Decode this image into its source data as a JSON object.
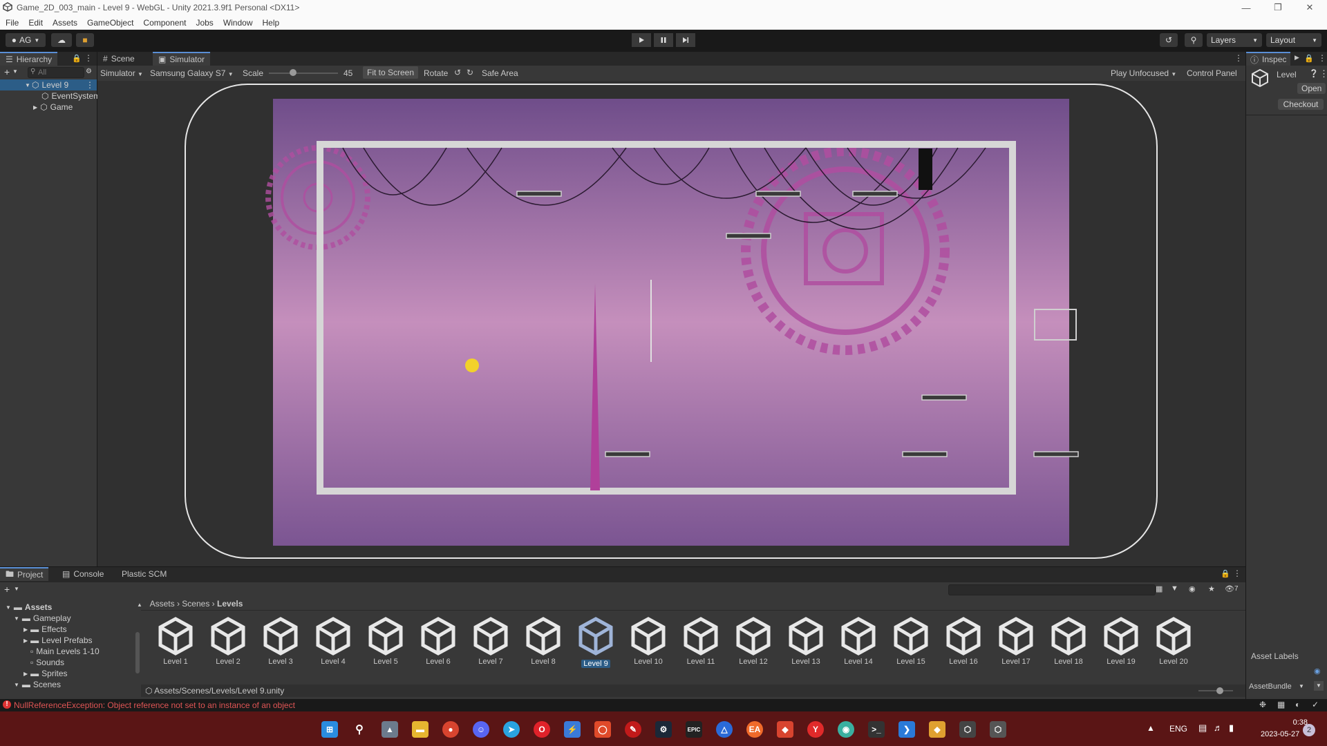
{
  "window": {
    "title": "Game_2D_003_main - Level 9 - WebGL - Unity 2021.3.9f1 Personal <DX11>"
  },
  "menu": [
    "File",
    "Edit",
    "Assets",
    "GameObject",
    "Component",
    "Jobs",
    "Window",
    "Help"
  ],
  "toolbar": {
    "account": "AG",
    "layers": "Layers",
    "layout": "Layout"
  },
  "hierarchy": {
    "tab": "Hierarchy",
    "search_placeholder": "All",
    "items": [
      {
        "label": "Level 9"
      },
      {
        "label": "EventSystem"
      },
      {
        "label": "Game"
      }
    ]
  },
  "scene": {
    "tabs": [
      "Scene",
      "Simulator"
    ],
    "mode": "Simulator",
    "device": "Samsung Galaxy S7",
    "scale_label": "Scale",
    "scale_value": "45",
    "scale_fraction": 0.35,
    "fit_label": "Fit to Screen",
    "rotate_label": "Rotate",
    "safe_area_label": "Safe Area",
    "play_mode": "Play Unfocused",
    "control_panel": "Control Panel"
  },
  "inspector": {
    "tab": "Inspec",
    "title": "Level",
    "open": "Open",
    "checkout": "Checkout",
    "asset_labels": "Asset Labels",
    "asset_bundle": "AssetBundle"
  },
  "project": {
    "tabs": [
      "Project",
      "Console",
      "Plastic SCM"
    ],
    "hidden_count": "7",
    "breadcrumb": [
      "Assets",
      "Scenes",
      "Levels"
    ],
    "tree": [
      {
        "label": "Assets"
      },
      {
        "label": "Gameplay"
      },
      {
        "label": "Effects"
      },
      {
        "label": "Level Prefabs"
      },
      {
        "label": "Main Levels 1-10"
      },
      {
        "label": "Sounds"
      },
      {
        "label": "Sprites"
      },
      {
        "label": "Scenes"
      }
    ],
    "assets": [
      "Level 1",
      "Level 2",
      "Level 3",
      "Level 4",
      "Level 5",
      "Level 6",
      "Level 7",
      "Level 8",
      "Level 9",
      "Level 10",
      "Level 11",
      "Level 12",
      "Level 13",
      "Level 14",
      "Level 15",
      "Level 16",
      "Level 17",
      "Level 18",
      "Level 19",
      "Level 20"
    ],
    "selected": "Level 9",
    "path": "Assets/Scenes/Levels/Level 9.unity"
  },
  "status": {
    "error": "NullReferenceException: Object reference not set to an instance of an object"
  },
  "taskbar": {
    "lang": "ENG",
    "time": "0:38",
    "date": "2023-05-27",
    "badge": "2"
  }
}
